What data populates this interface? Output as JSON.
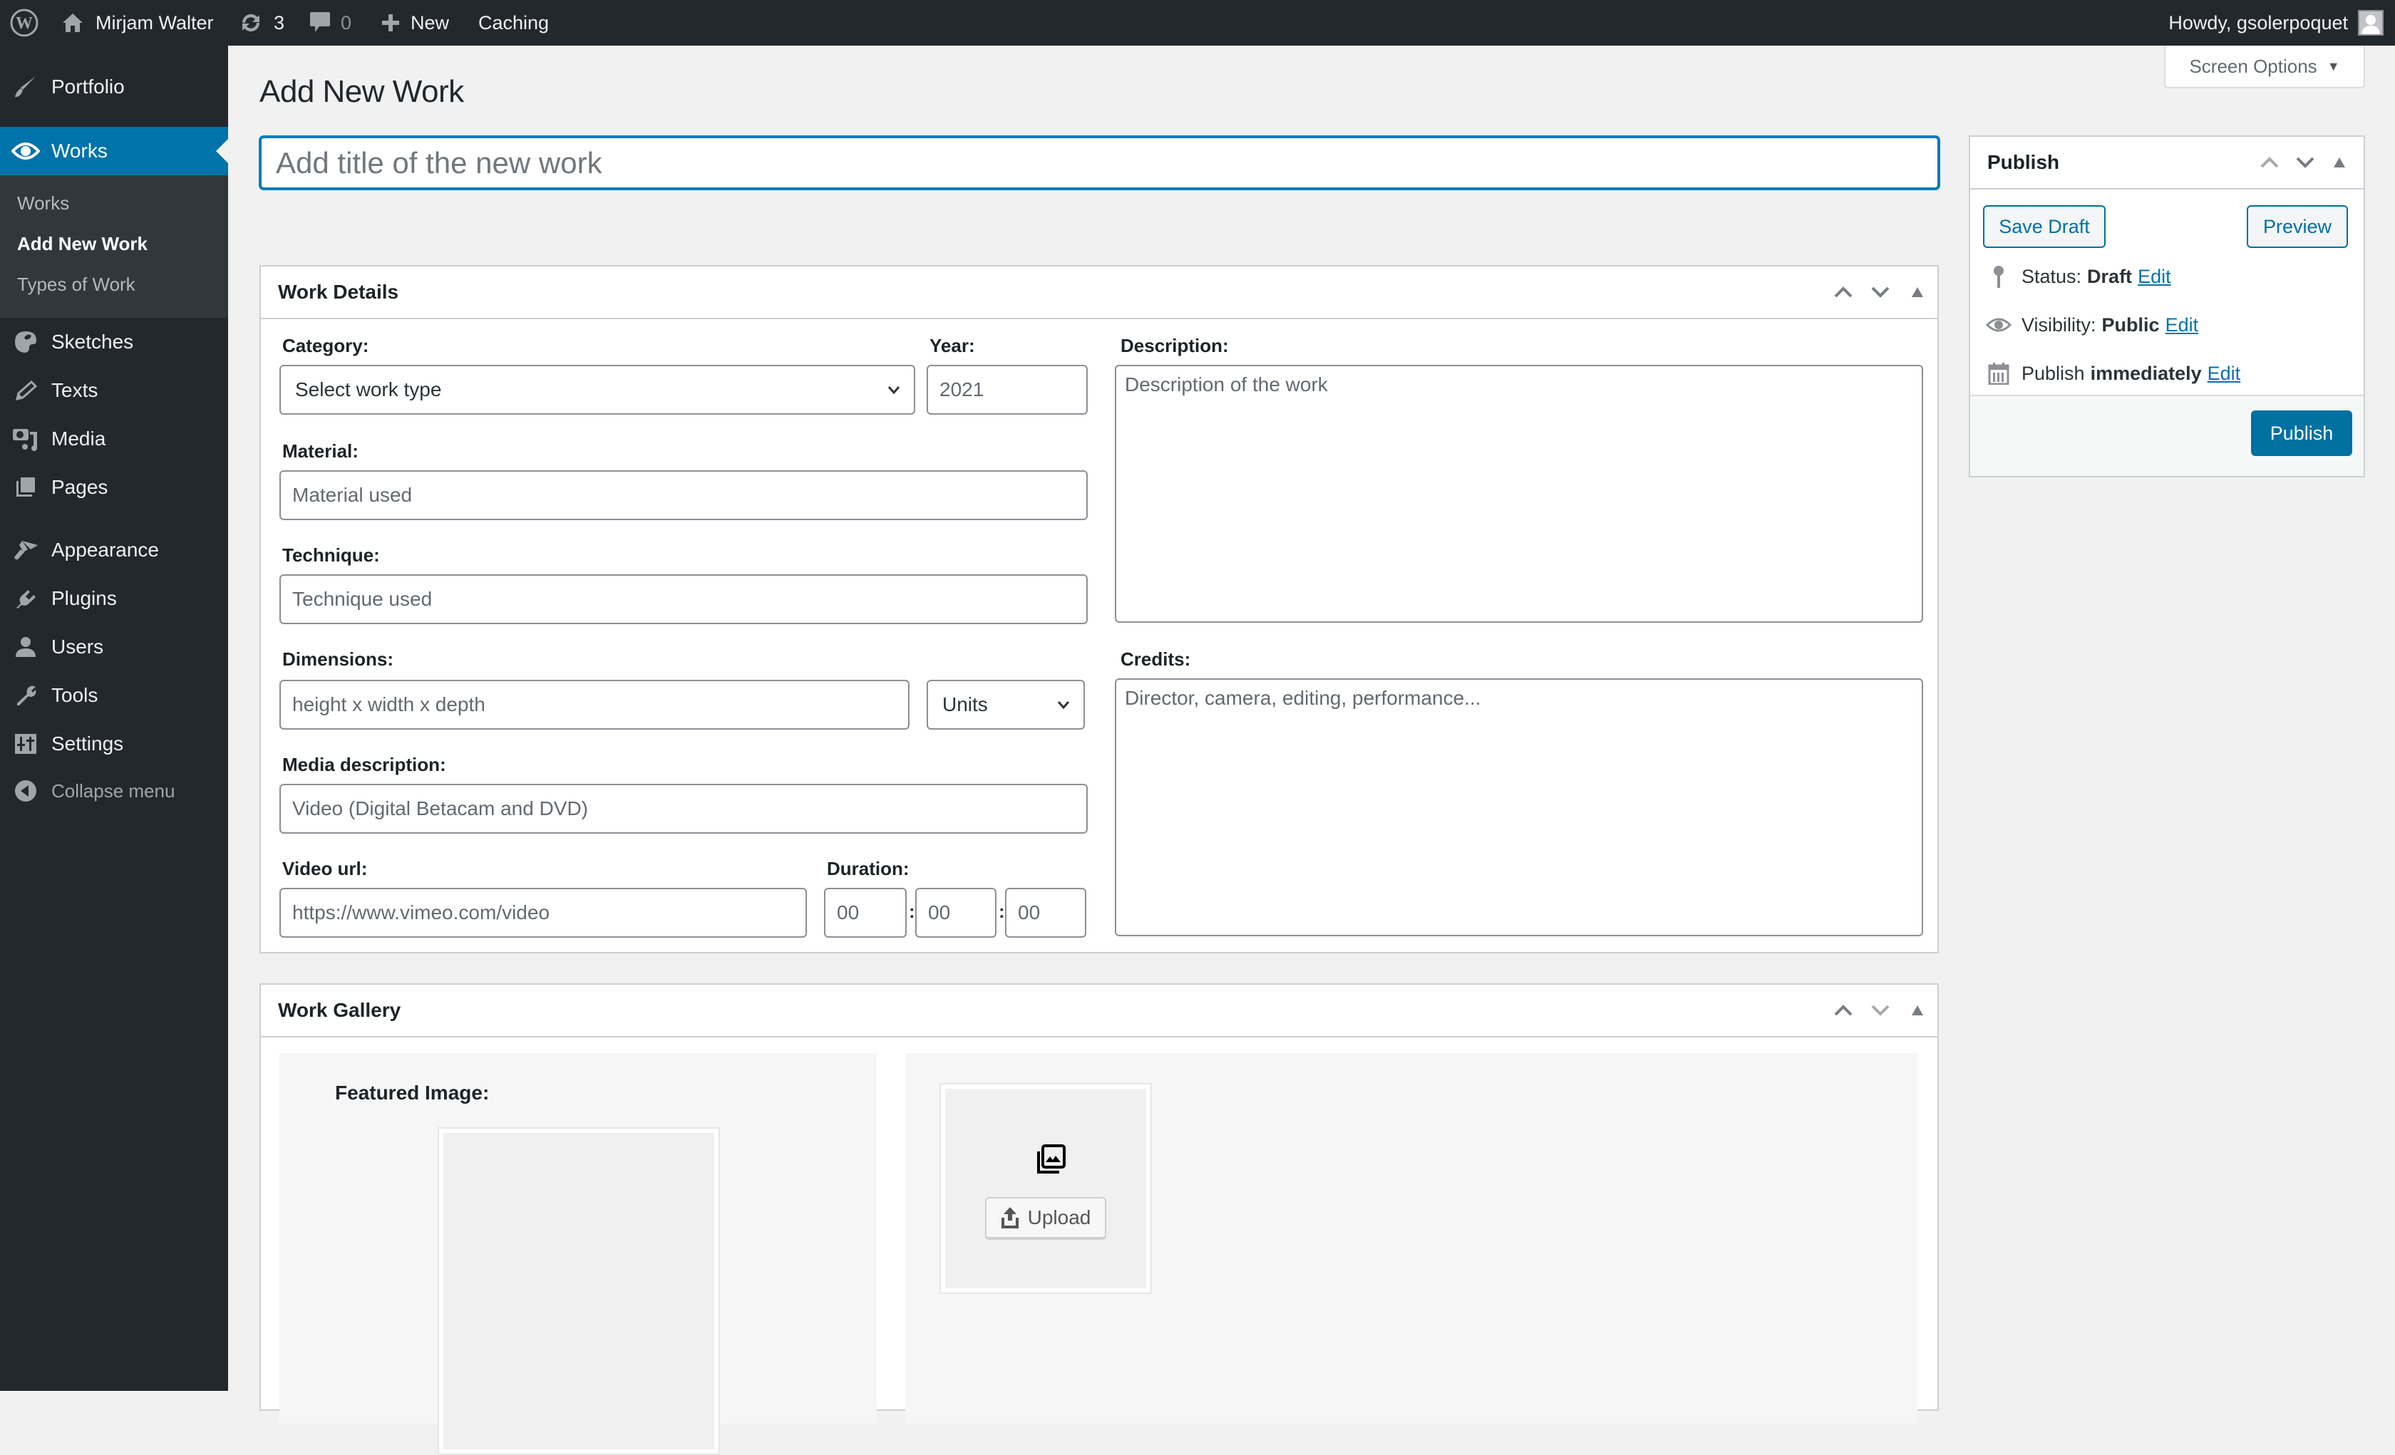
{
  "admin_bar": {
    "site_name": "Mirjam Walter",
    "updates_count": "3",
    "comments_count": "0",
    "new_label": "New",
    "caching_label": "Caching",
    "greeting": "Howdy, gsolerpoquet"
  },
  "sidebar": {
    "items": [
      {
        "label": "Portfolio",
        "icon": "paintbrush-icon"
      },
      {
        "label": "Works",
        "icon": "eye-icon",
        "active": true
      },
      {
        "label": "Sketches",
        "icon": "palette-icon"
      },
      {
        "label": "Texts",
        "icon": "pencil-icon"
      },
      {
        "label": "Media",
        "icon": "media-icon"
      },
      {
        "label": "Pages",
        "icon": "pages-icon"
      },
      {
        "label": "Appearance",
        "icon": "appearance-brush-icon"
      },
      {
        "label": "Plugins",
        "icon": "plugin-icon"
      },
      {
        "label": "Users",
        "icon": "user-icon"
      },
      {
        "label": "Tools",
        "icon": "wrench-icon"
      },
      {
        "label": "Settings",
        "icon": "settings-icon"
      }
    ],
    "submenu": [
      {
        "label": "Works"
      },
      {
        "label": "Add New Work",
        "current": true
      },
      {
        "label": "Types of Work"
      }
    ],
    "collapse_label": "Collapse menu"
  },
  "screen_options_label": "Screen Options",
  "page_title": "Add New Work",
  "title_input": {
    "placeholder": "Add title of the new work",
    "value": ""
  },
  "work_details": {
    "title": "Work Details",
    "category": {
      "label": "Category:",
      "selected": "Select work type"
    },
    "year": {
      "label": "Year:",
      "value": "2021"
    },
    "material": {
      "label": "Material:",
      "placeholder": "Material used"
    },
    "technique": {
      "label": "Technique:",
      "placeholder": "Technique used"
    },
    "dimensions": {
      "label": "Dimensions:",
      "placeholder": "height x width x depth",
      "units_selected": "Units"
    },
    "media_description": {
      "label": "Media description:",
      "placeholder": "Video (Digital Betacam and DVD)"
    },
    "video_url": {
      "label": "Video url:",
      "placeholder": "https://www.vimeo.com/video"
    },
    "duration": {
      "label": "Duration:",
      "hours": "00",
      "minutes": "00",
      "seconds": "00",
      "separator": ":"
    },
    "description": {
      "label": "Description:",
      "placeholder": "Description of the work"
    },
    "credits": {
      "label": "Credits:",
      "placeholder": "Director, camera, editing, performance..."
    }
  },
  "work_gallery": {
    "title": "Work Gallery",
    "featured_image_label": "Featured Image:",
    "upload_label": "Upload"
  },
  "publish": {
    "title": "Publish",
    "save_draft_label": "Save Draft",
    "preview_label": "Preview",
    "status_label": "Status:",
    "status_value": "Draft",
    "visibility_label": "Visibility:",
    "visibility_value": "Public",
    "schedule_label": "Publish",
    "schedule_value": "immediately",
    "edit_label": "Edit",
    "publish_label": "Publish"
  },
  "colors": {
    "admin_bar_bg": "#23282d",
    "accent": "#0073aa",
    "primary_button": "#0071a1",
    "page_bg": "#f1f1f1"
  }
}
